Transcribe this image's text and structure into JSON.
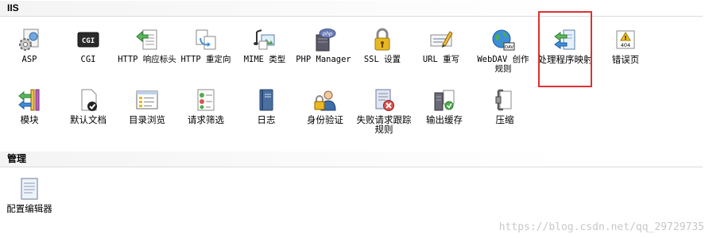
{
  "sections": {
    "iis": "IIS",
    "manage": "管理"
  },
  "iis_row1": [
    {
      "label": "ASP",
      "icon": "asp-gear-icon"
    },
    {
      "label": "CGI",
      "icon": "cgi-icon"
    },
    {
      "label": "HTTP 响应标头",
      "icon": "http-response-headers-icon"
    },
    {
      "label": "HTTP 重定向",
      "icon": "http-redirect-icon"
    },
    {
      "label": "MIME 类型",
      "icon": "mime-types-icon"
    },
    {
      "label": "PHP Manager",
      "icon": "php-manager-icon"
    },
    {
      "label": "SSL 设置",
      "icon": "ssl-lock-icon"
    },
    {
      "label": "URL 重写",
      "icon": "url-rewrite-icon"
    },
    {
      "label": "WebDAV 创作规则",
      "icon": "webdav-globe-icon"
    },
    {
      "label": "处理程序映射",
      "icon": "handler-mappings-icon"
    },
    {
      "label": "错误页",
      "icon": "error-pages-icon"
    }
  ],
  "iis_row2": [
    {
      "label": "模块",
      "icon": "modules-icon"
    },
    {
      "label": "默认文档",
      "icon": "default-document-icon"
    },
    {
      "label": "目录浏览",
      "icon": "directory-browsing-icon"
    },
    {
      "label": "请求筛选",
      "icon": "request-filtering-icon"
    },
    {
      "label": "日志",
      "icon": "logging-icon"
    },
    {
      "label": "身份验证",
      "icon": "authentication-icon"
    },
    {
      "label": "失败请求跟踪规则",
      "icon": "failed-request-tracing-icon"
    },
    {
      "label": "输出缓存",
      "icon": "output-caching-icon"
    },
    {
      "label": "压缩",
      "icon": "compression-icon"
    }
  ],
  "manage_row": [
    {
      "label": "配置编辑器",
      "icon": "configuration-editor-icon"
    }
  ],
  "icon_text": {
    "cgi": "CGI",
    "php": "php",
    "dav": "DAV",
    "err": "404"
  },
  "watermark": "https://blog.csdn.net/qq_29729735",
  "colors": {
    "highlight": "#e03030"
  }
}
